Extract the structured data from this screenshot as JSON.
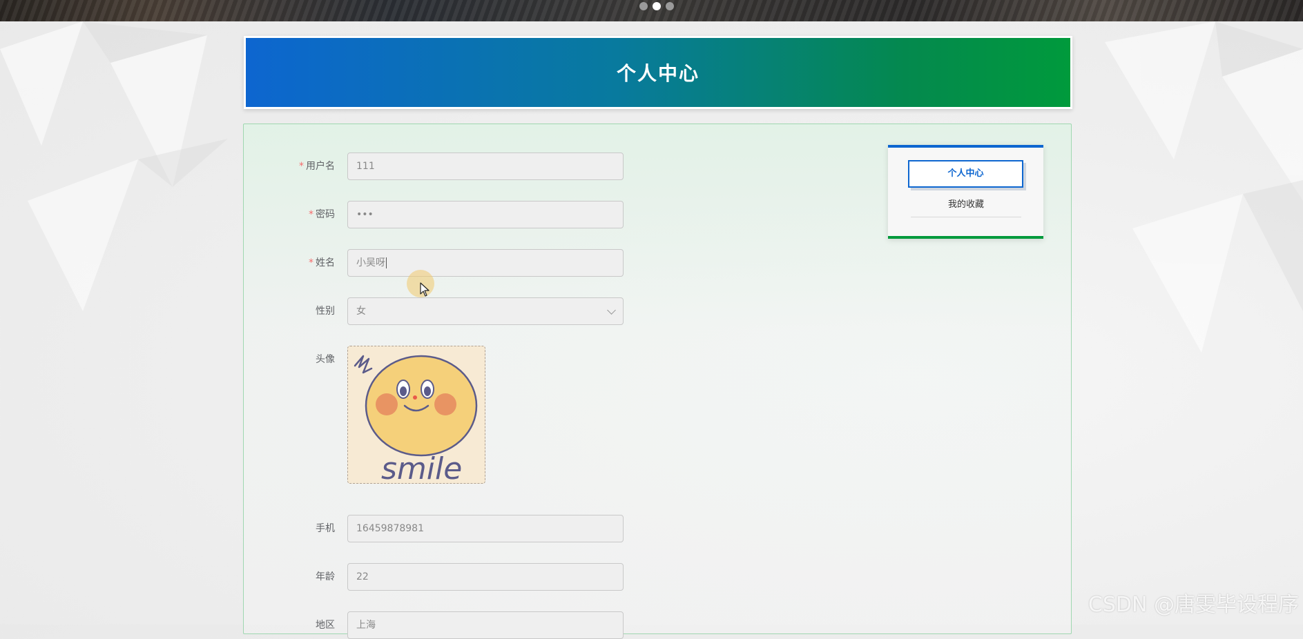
{
  "header": {
    "carousel_dots": 3,
    "active_dot": 1
  },
  "page": {
    "title": "个人中心"
  },
  "form": {
    "username": {
      "label": "用户名",
      "required": "*",
      "value": "111"
    },
    "password": {
      "label": "密码",
      "required": "*",
      "value": "•••"
    },
    "name": {
      "label": "姓名",
      "required": "*",
      "value": "小吴呀"
    },
    "gender": {
      "label": "性别",
      "value": "女"
    },
    "avatar": {
      "label": "头像",
      "image_text": "smile"
    },
    "phone": {
      "label": "手机",
      "value": "16459878981"
    },
    "age": {
      "label": "年龄",
      "value": "22"
    },
    "region": {
      "label": "地区",
      "value": "上海"
    }
  },
  "side_menu": {
    "items": [
      {
        "label": "个人中心",
        "active": true
      },
      {
        "label": "我的收藏",
        "active": false
      }
    ]
  },
  "watermark": "CSDN @唐雯毕设程序",
  "colors": {
    "brand_blue": "#0d66d0",
    "brand_green": "#009a3c",
    "required": "#f56c6c"
  }
}
